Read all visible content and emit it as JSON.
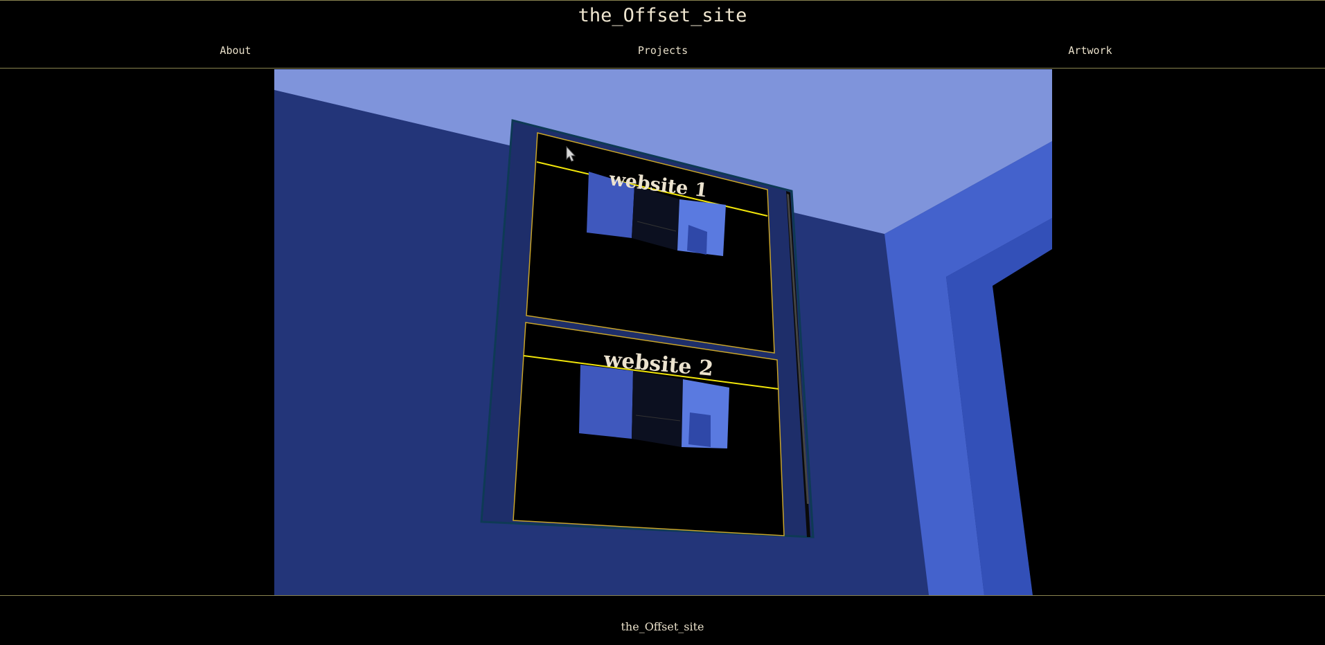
{
  "header": {
    "title": "the_Offset_site",
    "nav": [
      {
        "label": "About"
      },
      {
        "label": "Projects"
      },
      {
        "label": "Artwork"
      }
    ]
  },
  "scene": {
    "panels": [
      {
        "label": "website 1"
      },
      {
        "label": "website 2"
      }
    ]
  },
  "footer": {
    "text": "the_Offset_site"
  },
  "colors": {
    "ceiling": "#7f94db",
    "wall": "#233579",
    "pillar": "#4462cc",
    "pillar_dark": "#3350b8",
    "frame": "#0e3a55",
    "panel_border": "#c9a52a",
    "panel_line": "#f2e60a",
    "header_rule": "#8a8450"
  },
  "cursor": "pointer-arrow-icon"
}
